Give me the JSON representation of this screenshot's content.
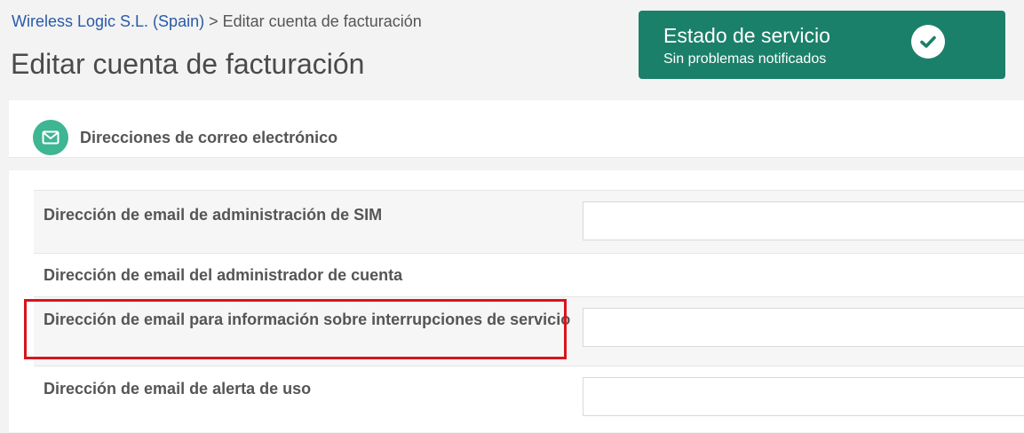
{
  "breadcrumb": {
    "link": "Wireless Logic S.L. (Spain)",
    "separator": ">",
    "current": "Editar cuenta de facturación"
  },
  "page_title": "Editar cuenta de facturación",
  "status": {
    "title": "Estado de servicio",
    "subtitle": "Sin problemas notificados",
    "icon": "check-circle-icon",
    "color": "#1b806a"
  },
  "section": {
    "icon": "envelope-icon",
    "title": "Direcciones de correo electrónico"
  },
  "fields": [
    {
      "label": "Dirección de email de administración de SIM",
      "value": ""
    },
    {
      "label": "Dirección de email del administrador de cuenta",
      "value": ""
    },
    {
      "label": "Dirección de email para información sobre interrupciones de servicio",
      "value": ""
    },
    {
      "label": "Dirección de email de alerta de uso",
      "value": ""
    }
  ],
  "highlight": {
    "color": "#d9141c",
    "target_field": "Dirección de email para información sobre interrupciones de servicio"
  }
}
